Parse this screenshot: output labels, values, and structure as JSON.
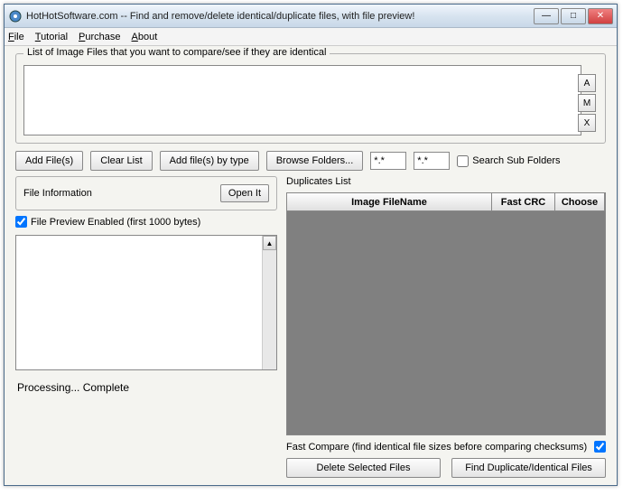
{
  "window": {
    "title": "HotHotSoftware.com -- Find and remove/delete identical/duplicate files, with file preview!"
  },
  "menu": {
    "file": "File",
    "tutorial": "Tutorial",
    "purchase": "Purchase",
    "about": "About"
  },
  "fileList": {
    "label": "List of Image Files that you want to compare/see if they are identical"
  },
  "sideButtons": {
    "a": "A",
    "m": "M",
    "x": "X"
  },
  "buttons": {
    "addFiles": "Add File(s)",
    "clearList": "Clear List",
    "addByType": "Add file(s) by type",
    "browseFolders": "Browse Folders...",
    "openIt": "Open It",
    "deleteSelected": "Delete Selected Files",
    "findDuplicates": "Find Duplicate/Identical Files"
  },
  "inputs": {
    "ext1": "*.*",
    "ext2": "*.*"
  },
  "checkboxes": {
    "searchSub": "Search Sub Folders",
    "previewEnabled": "File Preview Enabled (first 1000 bytes)",
    "fastCompare": "Fast Compare (find identical file sizes before comparing checksums)"
  },
  "labels": {
    "fileInfo": "File Information",
    "duplicatesList": "Duplicates List"
  },
  "grid": {
    "col1": "Image FileName",
    "col2": "Fast CRC",
    "col3": "Choose"
  },
  "status": "Processing... Complete"
}
